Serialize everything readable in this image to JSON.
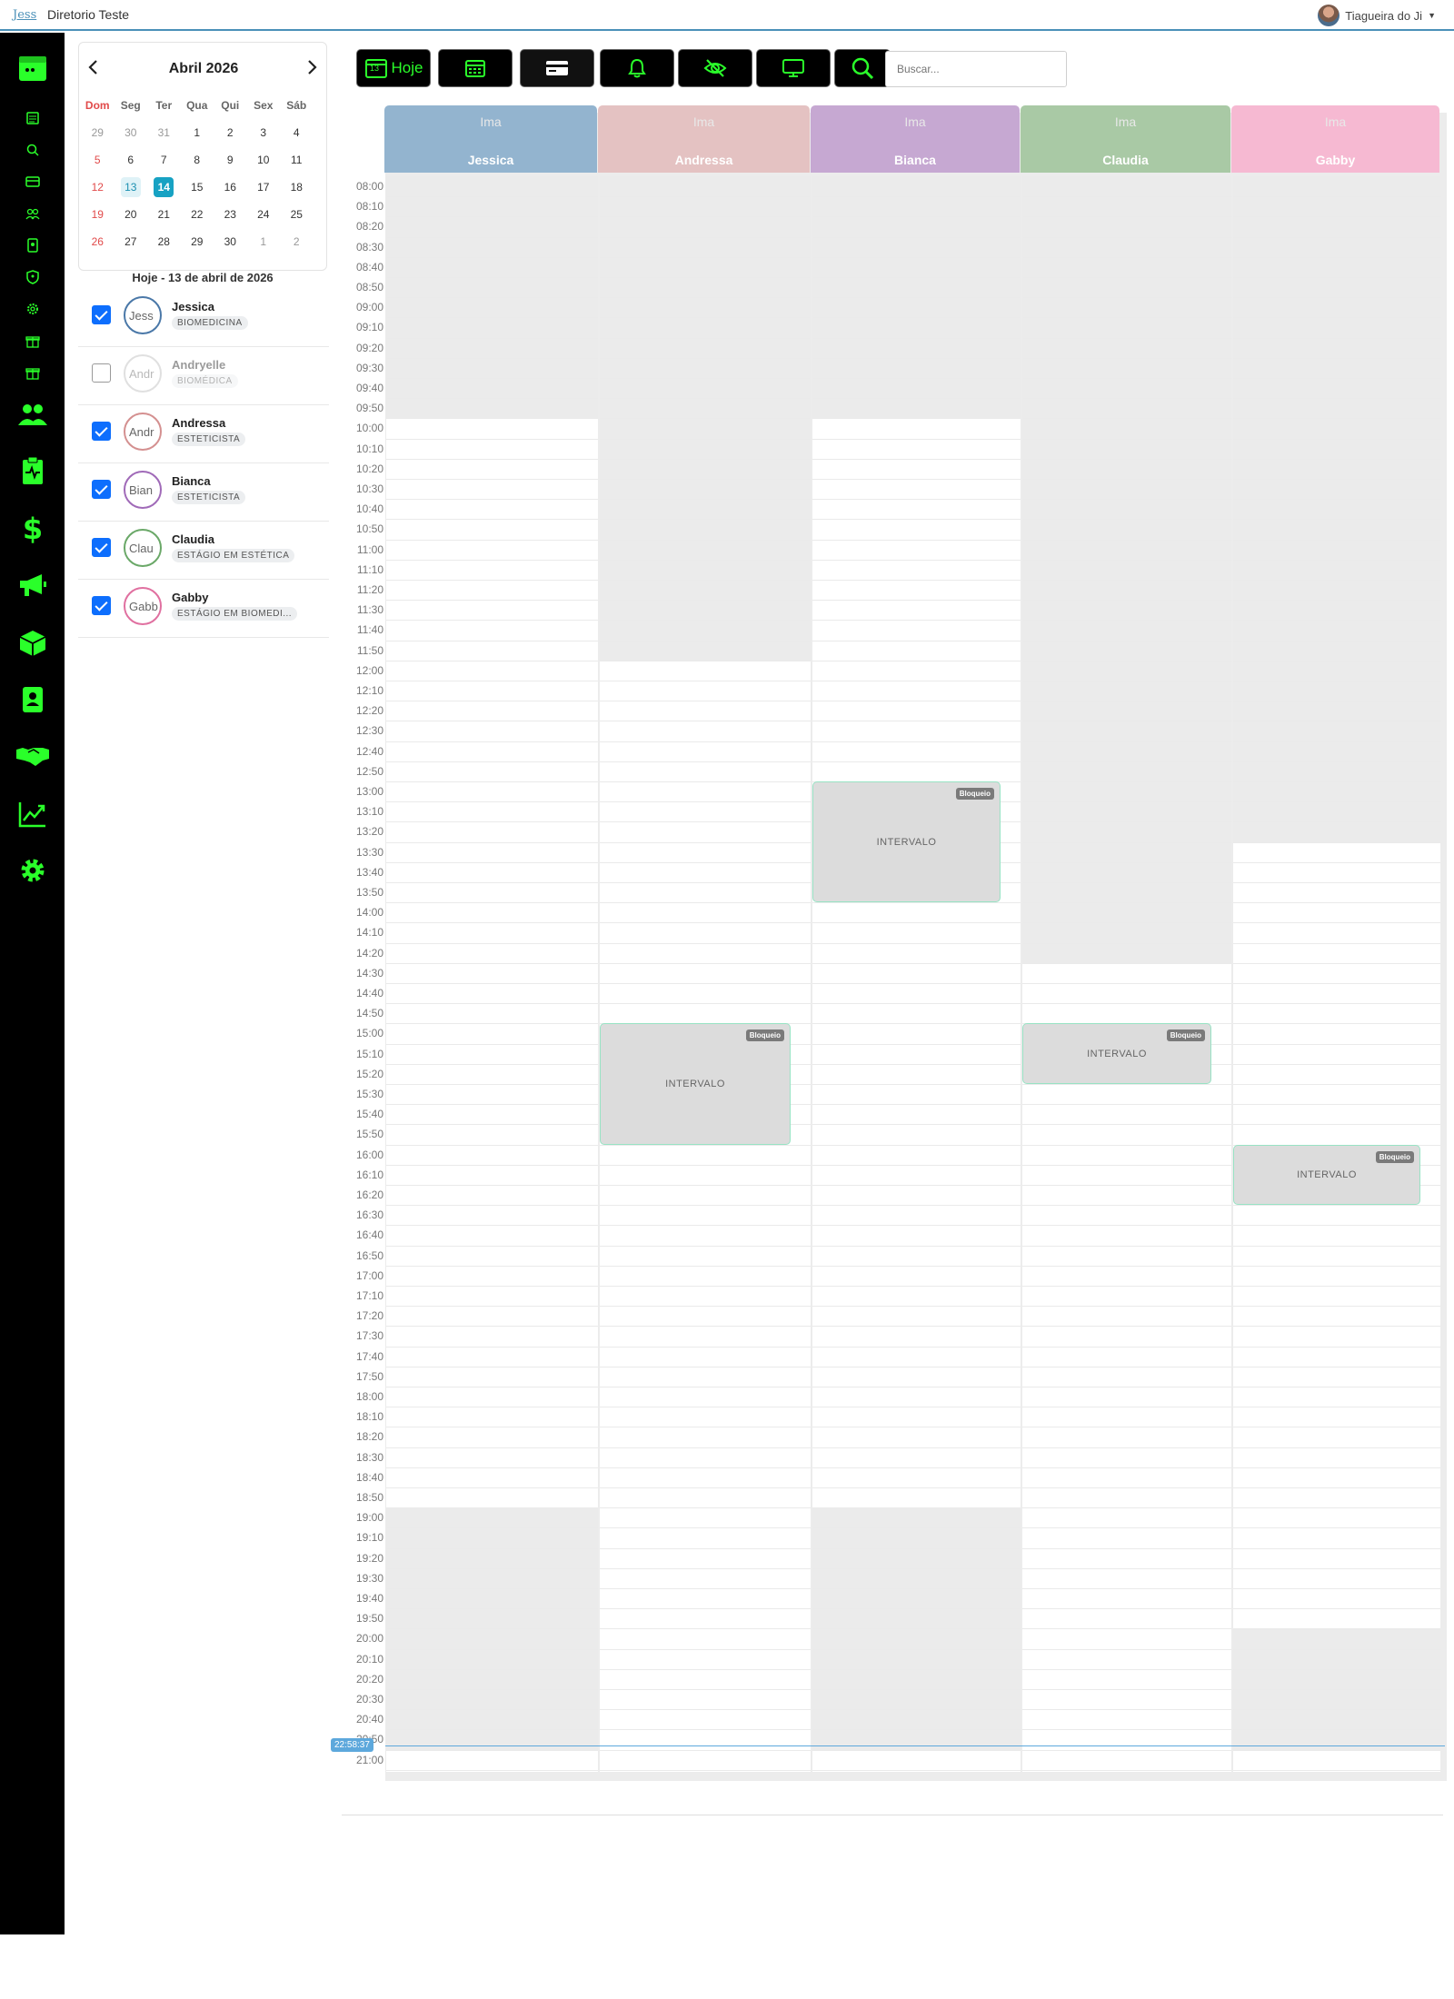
{
  "app": {
    "logo": "Jess",
    "title": "Diretorio Teste"
  },
  "user": {
    "name": "Tiagueira do Ji"
  },
  "sidebar_icons": [
    "calendar-app-icon",
    "list-icon",
    "search-icon",
    "card-icon",
    "users-small-icon",
    "badge-icon",
    "shield-icon",
    "gear-small-icon",
    "gift-icon",
    "gift-icon-2",
    "users-icon",
    "clipboard-icon",
    "dollar-icon",
    "megaphone-icon",
    "box-icon",
    "contact-icon",
    "handshake-icon",
    "chart-icon",
    "gear-icon"
  ],
  "mini_calendar": {
    "month_label": "Abril  2026",
    "prev": "‹",
    "next": "›",
    "weekdays": [
      "Dom",
      "Seg",
      "Ter",
      "Qua",
      "Qui",
      "Sex",
      "Sáb"
    ],
    "weeks": [
      [
        "29",
        "30",
        "31",
        "1",
        "2",
        "3",
        "4"
      ],
      [
        "5",
        "6",
        "7",
        "8",
        "9",
        "10",
        "11"
      ],
      [
        "12",
        "13",
        "14",
        "15",
        "16",
        "17",
        "18"
      ],
      [
        "19",
        "20",
        "21",
        "22",
        "23",
        "24",
        "25"
      ],
      [
        "26",
        "27",
        "28",
        "29",
        "30",
        "1",
        "2"
      ]
    ],
    "today": "13",
    "selected": "14"
  },
  "today_label": "Hoje - 13 de abril de 2026",
  "professionals": [
    {
      "name": "Jessica",
      "role": "BIOMEDICINA",
      "avatar_alt": "Jess",
      "checked": true,
      "color": "#4a78a8"
    },
    {
      "name": "Andryelle",
      "role": "BIOMÉDICA",
      "avatar_alt": "Andr",
      "checked": false,
      "color": "#bbbbbb"
    },
    {
      "name": "Andressa",
      "role": "ESTETICISTA",
      "avatar_alt": "Andr",
      "checked": true,
      "color": "#d49090"
    },
    {
      "name": "Bianca",
      "role": "ESTETICISTA",
      "avatar_alt": "Bian",
      "checked": true,
      "color": "#a06ab8"
    },
    {
      "name": "Claudia",
      "role": "ESTÁGIO EM ESTÉTICA",
      "avatar_alt": "Clau",
      "checked": true,
      "color": "#6aa868"
    },
    {
      "name": "Gabby",
      "role": "ESTÁGIO EM BIOMEDI...",
      "avatar_alt": "Gabb",
      "checked": true,
      "color": "#e070a0"
    }
  ],
  "toolbar": {
    "today_label": "Hoje",
    "today_day": "13",
    "search_placeholder": "Buscar..."
  },
  "schedule": {
    "image_placeholder": "Ima",
    "columns": [
      {
        "name": "Jessica",
        "color": "#93b4cf"
      },
      {
        "name": "Andressa",
        "color": "#e4c2c2"
      },
      {
        "name": "Bianca",
        "color": "#c6a8d2"
      },
      {
        "name": "Claudia",
        "color": "#a9c9a5"
      },
      {
        "name": "Gabby",
        "color": "#f6b9d2"
      }
    ],
    "times": [
      "08:00",
      "08:10",
      "08:20",
      "08:30",
      "08:40",
      "08:50",
      "09:00",
      "09:10",
      "09:20",
      "09:30",
      "09:40",
      "09:50",
      "10:00",
      "10:10",
      "10:20",
      "10:30",
      "10:40",
      "10:50",
      "11:00",
      "11:10",
      "11:20",
      "11:30",
      "11:40",
      "11:50",
      "12:00",
      "12:10",
      "12:20",
      "12:30",
      "12:40",
      "12:50",
      "13:00",
      "13:10",
      "13:20",
      "13:30",
      "13:40",
      "13:50",
      "14:00",
      "14:10",
      "14:20",
      "14:30",
      "14:40",
      "14:50",
      "15:00",
      "15:10",
      "15:20",
      "15:30",
      "15:40",
      "15:50",
      "16:00",
      "16:10",
      "16:20",
      "16:30",
      "16:40",
      "16:50",
      "17:00",
      "17:10",
      "17:20",
      "17:30",
      "17:40",
      "17:50",
      "18:00",
      "18:10",
      "18:20",
      "18:30",
      "18:40",
      "18:50",
      "19:00",
      "19:10",
      "19:20",
      "19:30",
      "19:40",
      "19:50",
      "20:00",
      "20:10",
      "20:20",
      "20:30",
      "20:40",
      "20:50",
      "21:00"
    ],
    "blocks": [
      {
        "column": "Bianca",
        "start": "13:00",
        "end": "13:50",
        "label": "INTERVALO",
        "tag": "Bloqueio"
      },
      {
        "column": "Andressa",
        "start": "15:00",
        "end": "15:50",
        "label": "INTERVALO",
        "tag": "Bloqueio"
      },
      {
        "column": "Claudia",
        "start": "15:00",
        "end": "15:20",
        "label": "INTERVALO",
        "tag": "Bloqueio"
      },
      {
        "column": "Gabby",
        "start": "16:00",
        "end": "16:20",
        "label": "INTERVALO",
        "tag": "Bloqueio"
      }
    ],
    "unavailable": [
      {
        "column": "Jessica",
        "ranges": [
          [
            "08:00",
            "10:00"
          ],
          [
            "19:00",
            "21:00"
          ]
        ]
      },
      {
        "column": "Andressa",
        "ranges": [
          [
            "08:00",
            "12:00"
          ]
        ]
      },
      {
        "column": "Bianca",
        "ranges": [
          [
            "08:00",
            "10:00"
          ],
          [
            "19:00",
            "21:00"
          ]
        ]
      },
      {
        "column": "Claudia",
        "ranges": [
          [
            "08:00",
            "14:30"
          ]
        ]
      },
      {
        "column": "Gabby",
        "ranges": [
          [
            "08:00",
            "13:30"
          ],
          [
            "20:00",
            "21:00"
          ]
        ]
      }
    ],
    "now_time": "22:58:37"
  }
}
